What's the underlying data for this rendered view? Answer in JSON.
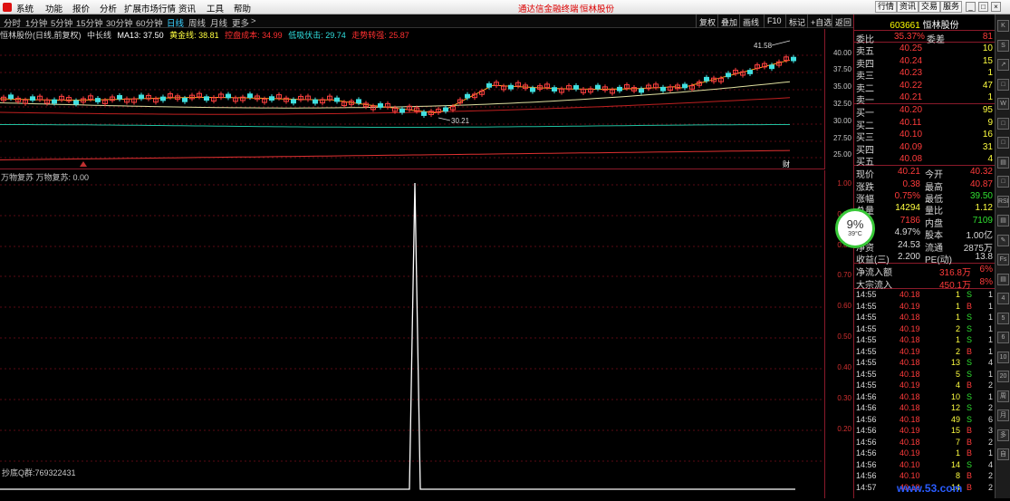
{
  "menu": {
    "items": [
      "系统",
      "功能",
      "报价",
      "分析",
      "扩展市场行情",
      "资讯",
      "工具",
      "帮助"
    ],
    "center_link1": "通达信金融终端",
    "center_link2": "恒林股份",
    "right_buttons": [
      "行情",
      "资讯",
      "交易",
      "服务"
    ]
  },
  "periods": {
    "items": [
      "分时",
      "1分钟",
      "5分钟",
      "15分钟",
      "30分钟",
      "60分钟",
      "日线",
      "周线",
      "月线",
      "更多"
    ],
    "active": "日线",
    "chevron": ">"
  },
  "toolbar": {
    "buttons": [
      "复权",
      "叠加",
      "画线",
      "F10",
      "标记",
      "+自选",
      "返回"
    ]
  },
  "kinfo": {
    "name": "恒林股份(日线,前复权)",
    "period": "中长线",
    "ma13": "MA13: 37.50",
    "gold": "黄金线: 38.81",
    "cost": "控盘成本: 34.99",
    "low": "低吸伏击: 29.74",
    "trend": "走势转强: 25.87"
  },
  "kaxis": {
    "ticks": [
      "40.00",
      "37.50",
      "35.00",
      "32.50",
      "30.00",
      "27.50",
      "25.00"
    ]
  },
  "kchart": {
    "high_label": "41.58",
    "low_label": "30.21",
    "cai": "财"
  },
  "indicator": {
    "title": "万物复苏  万物复苏: 0.00",
    "qq": "抄底Q群:769322431",
    "ticks": [
      "1.00",
      "0.90",
      "0.80",
      "0.70",
      "0.60",
      "0.50",
      "0.40",
      "0.30",
      "0.20"
    ]
  },
  "weather": {
    "pct": "9%",
    "temp": "39°C"
  },
  "quote": {
    "code": "603661",
    "name": "恒林股份",
    "weibi": {
      "l": "委比",
      "v": "35.37%",
      "l2": "委差",
      "v2": "81"
    },
    "asks": [
      {
        "l": "卖五",
        "p": "40.25",
        "v": "10"
      },
      {
        "l": "卖四",
        "p": "40.24",
        "v": "15"
      },
      {
        "l": "卖三",
        "p": "40.23",
        "v": "1"
      },
      {
        "l": "卖二",
        "p": "40.22",
        "v": "47"
      },
      {
        "l": "卖一",
        "p": "40.21",
        "v": "1"
      }
    ],
    "bids": [
      {
        "l": "买一",
        "p": "40.20",
        "v": "95"
      },
      {
        "l": "买二",
        "p": "40.11",
        "v": "9"
      },
      {
        "l": "买三",
        "p": "40.10",
        "v": "16"
      },
      {
        "l": "买四",
        "p": "40.09",
        "v": "31"
      },
      {
        "l": "买五",
        "p": "40.08",
        "v": "4"
      }
    ],
    "stats": [
      {
        "l": "现价",
        "v": "40.21",
        "l2": "今开",
        "v2": "40.32",
        "c": "red",
        "c2": "red"
      },
      {
        "l": "涨跌",
        "v": "0.38",
        "l2": "最高",
        "v2": "40.87",
        "c": "red",
        "c2": "red"
      },
      {
        "l": "涨幅",
        "v": "0.75%",
        "l2": "最低",
        "v2": "39.50",
        "c": "red",
        "c2": "grn"
      },
      {
        "l": "总量",
        "v": "14294",
        "l2": "量比",
        "v2": "1.12",
        "c": "yel",
        "c2": "yel"
      },
      {
        "l": "外盘",
        "v": "7186",
        "l2": "内盘",
        "v2": "7109",
        "c": "red",
        "c2": "grn"
      },
      {
        "l": "换手",
        "v": "4.97%",
        "l2": "股本",
        "v2": "1.00亿",
        "c": "wht",
        "c2": "wht"
      },
      {
        "l": "净资",
        "v": "24.53",
        "l2": "流通",
        "v2": "2875万",
        "c": "wht",
        "c2": "wht"
      },
      {
        "l": "收益(三)",
        "v": "2.200",
        "l2": "PE(动)",
        "v2": "13.8",
        "c": "wht",
        "c2": "wht"
      }
    ],
    "flows": [
      {
        "l": "净流入额",
        "v": "316.8万",
        "p": "6%"
      },
      {
        "l": "大宗流入",
        "v": "450.1万",
        "p": "8%"
      }
    ]
  },
  "ticks": [
    {
      "t": "14:55",
      "p": "40.18",
      "v": "1",
      "d": "S",
      "n": "1"
    },
    {
      "t": "14:55",
      "p": "40.19",
      "v": "1",
      "d": "B",
      "n": "1"
    },
    {
      "t": "14:55",
      "p": "40.18",
      "v": "1",
      "d": "S",
      "n": "1"
    },
    {
      "t": "14:55",
      "p": "40.19",
      "v": "2",
      "d": "S",
      "n": "1"
    },
    {
      "t": "14:55",
      "p": "40.18",
      "v": "1",
      "d": "S",
      "n": "1"
    },
    {
      "t": "14:55",
      "p": "40.19",
      "v": "2",
      "d": "B",
      "n": "1"
    },
    {
      "t": "14:55",
      "p": "40.18",
      "v": "13",
      "d": "S",
      "n": "4"
    },
    {
      "t": "14:55",
      "p": "40.18",
      "v": "5",
      "d": "S",
      "n": "1"
    },
    {
      "t": "14:55",
      "p": "40.19",
      "v": "4",
      "d": "B",
      "n": "2"
    },
    {
      "t": "14:56",
      "p": "40.18",
      "v": "10",
      "d": "S",
      "n": "1"
    },
    {
      "t": "14:56",
      "p": "40.18",
      "v": "12",
      "d": "S",
      "n": "2"
    },
    {
      "t": "14:56",
      "p": "40.18",
      "v": "49",
      "d": "S",
      "n": "6"
    },
    {
      "t": "14:56",
      "p": "40.19",
      "v": "15",
      "d": "B",
      "n": "3"
    },
    {
      "t": "14:56",
      "p": "40.18",
      "v": "7",
      "d": "B",
      "n": "2"
    },
    {
      "t": "14:56",
      "p": "40.19",
      "v": "1",
      "d": "B",
      "n": "1"
    },
    {
      "t": "14:56",
      "p": "40.10",
      "v": "14",
      "d": "S",
      "n": "4"
    },
    {
      "t": "14:56",
      "p": "40.10",
      "v": "8",
      "d": "B",
      "n": "2"
    },
    {
      "t": "14:57",
      "p": "40.10",
      "v": "14",
      "d": "B",
      "n": "2"
    }
  ],
  "sidebar": {
    "icons": [
      "K",
      "S",
      "↗",
      "□",
      "W",
      "□",
      "□",
      "▤",
      "□",
      "RSI",
      "▤",
      "✎",
      "Fs",
      "▤",
      "4",
      "5",
      "6",
      "10",
      "20",
      "周",
      "月",
      "多",
      "自"
    ]
  },
  "watermark": "www.53.com"
}
